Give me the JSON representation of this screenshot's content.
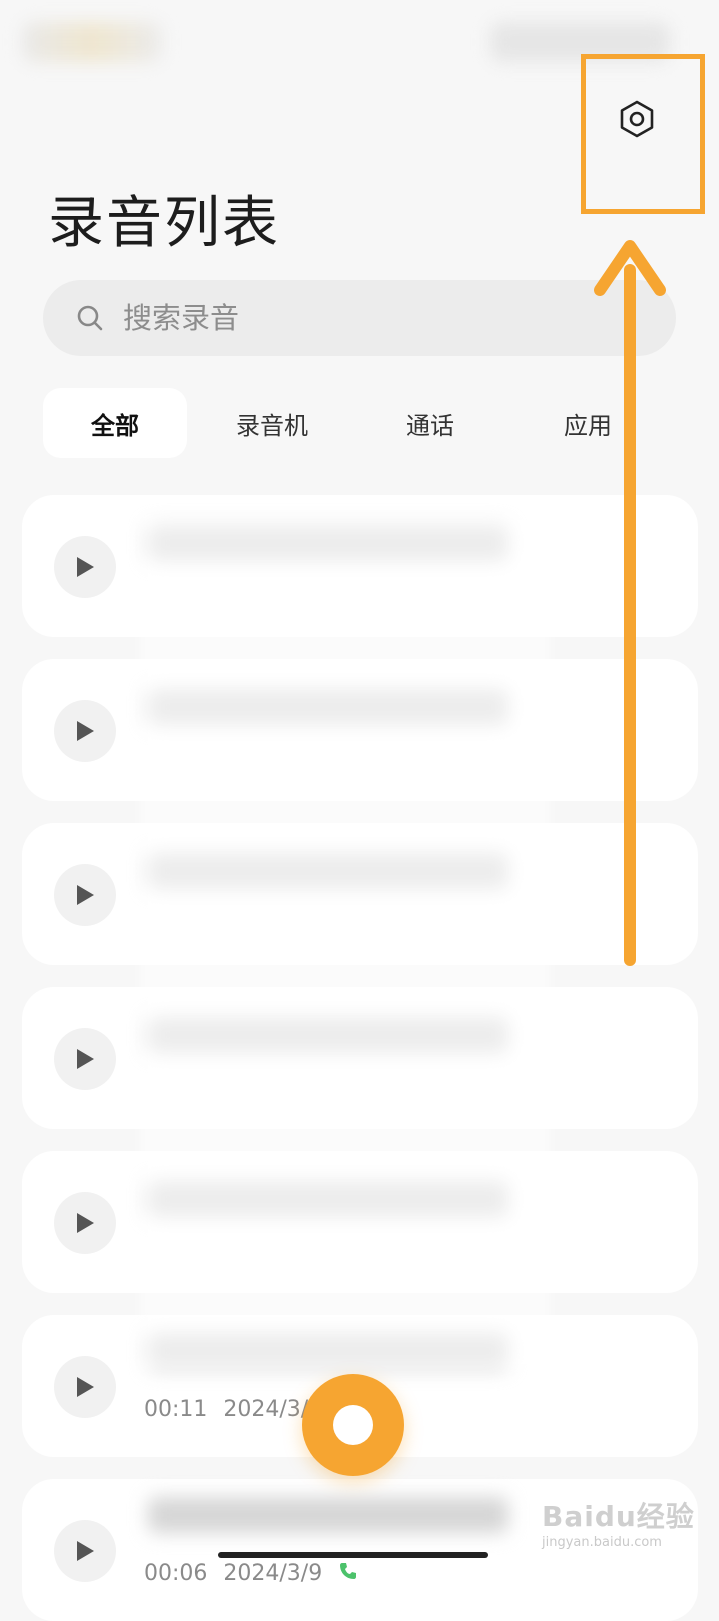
{
  "page": {
    "title": "录音列表"
  },
  "search": {
    "placeholder": "搜索录音"
  },
  "tabs": [
    {
      "label": "全部",
      "active": true
    },
    {
      "label": "录音机",
      "active": false
    },
    {
      "label": "通话",
      "active": false
    },
    {
      "label": "应用",
      "active": false
    }
  ],
  "recordings": [
    {
      "duration": "",
      "date": ""
    },
    {
      "duration": "",
      "date": ""
    },
    {
      "duration": "",
      "date": ""
    },
    {
      "duration": "",
      "date": ""
    },
    {
      "duration": "",
      "date": ""
    },
    {
      "duration": "00:11",
      "date": "2024/3/9"
    },
    {
      "duration": "00:06",
      "date": "2024/3/9"
    }
  ],
  "icons": {
    "settings": "settings-gear-icon",
    "search": "search-icon",
    "play": "play-icon",
    "record": "record-icon",
    "call": "phone-icon"
  },
  "colors": {
    "accent": "#f6a531",
    "background": "#f7f7f7",
    "card": "#ffffff",
    "call_icon": "#4cc26b"
  },
  "watermark": {
    "brand": "Baidu经验",
    "domain": "jingyan.baidu.com"
  }
}
